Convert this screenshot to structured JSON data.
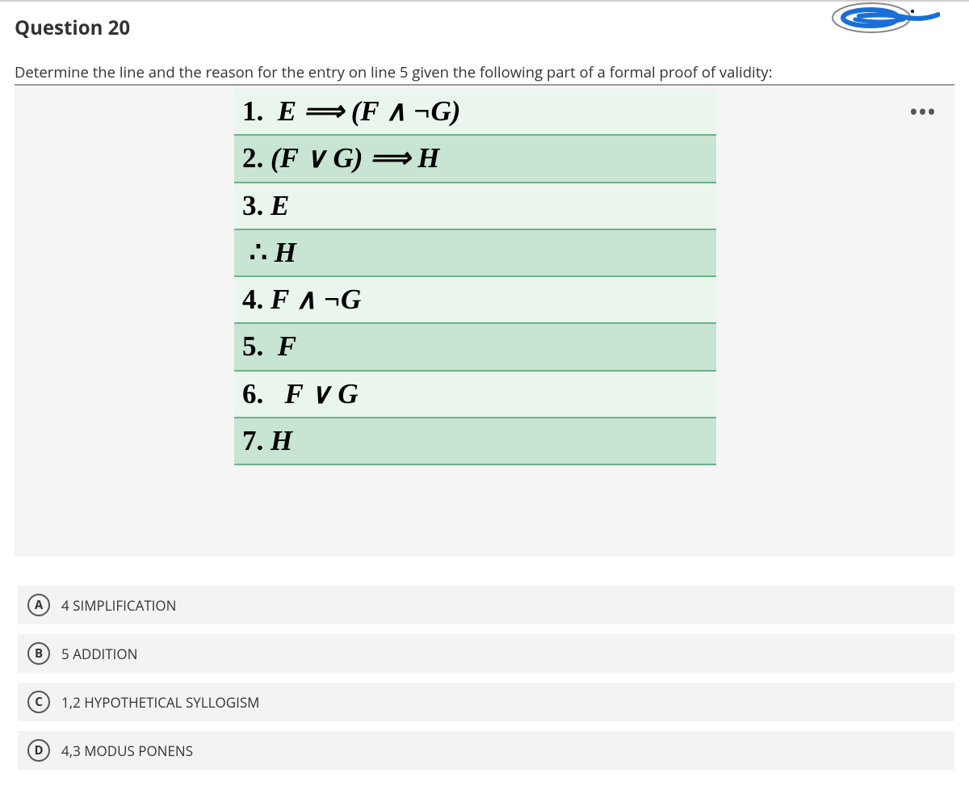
{
  "question": {
    "title": "Question 20",
    "prompt": "Determine the line and the reason for the entry on line 5 given the following part of a formal proof of validity:"
  },
  "proof": {
    "lines": [
      {
        "num": "1.",
        "text": "E ⟹ (F ∧ ¬G)"
      },
      {
        "num": "2.",
        "text": "(F ∨ G) ⟹ H"
      },
      {
        "num": "3.",
        "text": "E"
      },
      {
        "num": "∴",
        "text": "H"
      },
      {
        "num": "4.",
        "text": "F ∧ ¬G"
      },
      {
        "num": "5.",
        "text": "F"
      },
      {
        "num": "6.",
        "text": "F ∨ G"
      },
      {
        "num": "7.",
        "text": "H"
      }
    ]
  },
  "options": [
    {
      "letter": "A",
      "label": "4 SIMPLIFICATION"
    },
    {
      "letter": "B",
      "label": "5 ADDITION"
    },
    {
      "letter": "C",
      "label": "1,2 HYPOTHETICAL SYLLOGISM"
    },
    {
      "letter": "D",
      "label": "4,3 MODUS PONENS"
    }
  ],
  "icons": {
    "more": "•••"
  }
}
